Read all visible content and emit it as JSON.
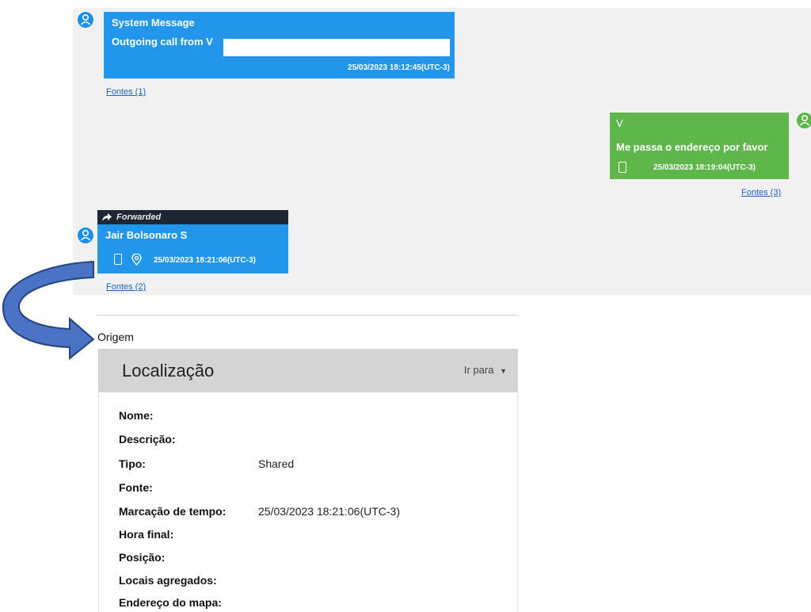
{
  "chat": {
    "system_message": {
      "sender": "System Message",
      "text": "Outgoing call from V",
      "time": "25/03/2023 18:12:45(UTC-3)",
      "sources": "Fontes (1)"
    },
    "outgoing_message": {
      "sender": "V",
      "text": "Me passa o endereço por favor",
      "time": "25/03/2023 18:19:04(UTC-3)",
      "sources": "Fontes (3)"
    },
    "forwarded_message": {
      "forwarded_label": "Forwarded",
      "sender": "Jair Bolsonaro S",
      "time": "25/03/2023 18:21:06(UTC-3)",
      "sources": "Fontes (2)"
    },
    "colors": {
      "blue": "#2196eb",
      "green": "#5fb64a",
      "forwarded_bar": "#1f2633",
      "link": "#1b63b8"
    }
  },
  "origin": {
    "label": "Origem",
    "panel_title": "Localização",
    "go_to": "Ir para",
    "fields": [
      {
        "label": "Nome:",
        "value": ""
      },
      {
        "label": "Descrição:",
        "value": ""
      },
      {
        "label": "Tipo:",
        "value": "Shared"
      },
      {
        "label": "Fonte:",
        "value": ""
      },
      {
        "label": "Marcação de tempo:",
        "value": "25/03/2023 18:21:06(UTC-3)"
      },
      {
        "label": "Hora final:",
        "value": ""
      },
      {
        "label": "Posição:",
        "value": ""
      },
      {
        "label": "Locais agregados:",
        "value": ""
      },
      {
        "label": "Endereço do mapa:",
        "value": ""
      }
    ]
  }
}
